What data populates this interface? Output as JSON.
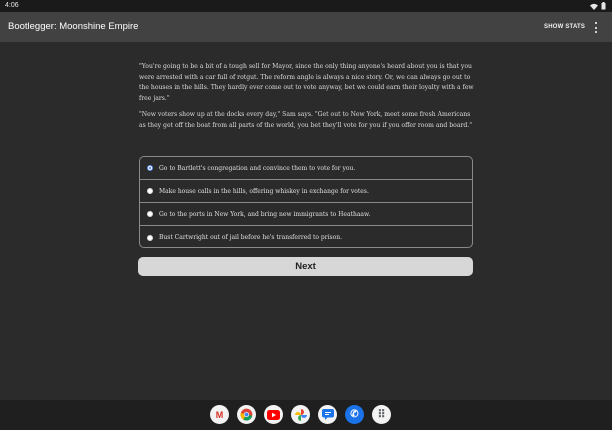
{
  "status_bar": {
    "time": "4:06"
  },
  "app_bar": {
    "title": "Bootlegger: Moonshine Empire",
    "show_stats_label": "SHOW STATS"
  },
  "story": {
    "paragraphs": [
      "\"You're going to be a bit of a tough sell for Mayor, since the only thing anyone's heard about you is that you were arrested with a car full of rotgut. The reform angle is always a nice story. Or, we can always go out to the houses in the hills. They hardly ever come out to vote anyway, bet we could earn their loyalty with a few free jars.\"",
      "\"New voters show up at the docks every day,\" Sam says. \"Get out to New York, meet some fresh Americans as they get off the boat from all parts of the world, you bet they'll vote for you if you offer room and board.\""
    ]
  },
  "choices": [
    {
      "label": "Go to Bartlett's congregation and convince them to vote for you.",
      "selected": true
    },
    {
      "label": "Make house calls in the hills, offering whiskey in exchange for votes.",
      "selected": false
    },
    {
      "label": "Go to the ports in New York, and bring new immigrants to Heathaaw.",
      "selected": false
    },
    {
      "label": "Bust Cartwright out of jail before he's transferred to prison.",
      "selected": false
    }
  ],
  "next_button": {
    "label": "Next"
  },
  "dock": {
    "apps": [
      {
        "icon": "gmail-icon",
        "glyph": "M",
        "color": "#d93025"
      },
      {
        "icon": "chrome-icon",
        "glyph": "",
        "color": "#4285f4"
      },
      {
        "icon": "youtube-icon",
        "glyph": "▶",
        "color": "#ff0000"
      },
      {
        "icon": "photos-icon",
        "glyph": "✿",
        "color": "#fbbc04"
      },
      {
        "icon": "messages-icon",
        "glyph": "▭",
        "color": "#1a73e8"
      },
      {
        "icon": "phone-icon",
        "glyph": "✆",
        "color": "#1a73e8"
      },
      {
        "icon": "app-drawer-icon",
        "glyph": "⠿",
        "color": "#5f6368"
      }
    ]
  }
}
